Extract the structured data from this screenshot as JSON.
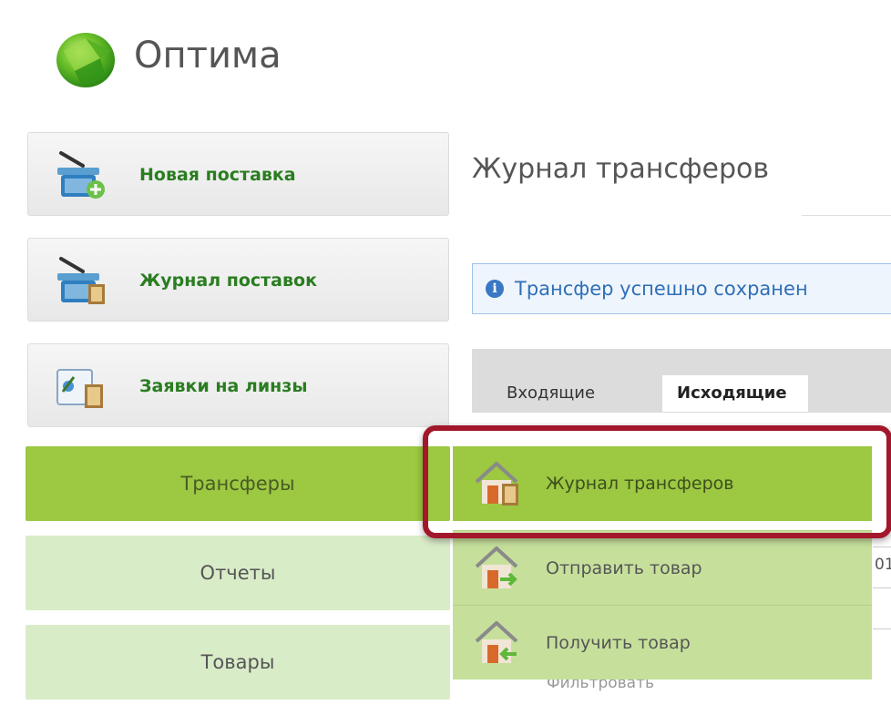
{
  "app": {
    "title": "Оптима",
    "accent": "#9cc842"
  },
  "actions": [
    {
      "label": "Новая поставка",
      "icon": "basket-add-icon"
    },
    {
      "label": "Журнал поставок",
      "icon": "basket-journal-icon"
    },
    {
      "label": "Заявки на линзы",
      "icon": "lens-request-icon"
    }
  ],
  "nav": [
    {
      "label": "Трансферы",
      "state": "active"
    },
    {
      "label": "Отчеты",
      "state": "normal"
    },
    {
      "label": "Товары",
      "state": "normal"
    }
  ],
  "main": {
    "title": "Журнал трансферов",
    "info_text": "Трансфер успешно сохранен",
    "tabs": [
      {
        "label": "Входящие",
        "active": false
      },
      {
        "label": "Исходящие",
        "active": true
      }
    ],
    "peek_text_1": "01",
    "peek_text_2": "Фильтровать"
  },
  "submenu": [
    {
      "label": "Журнал трансферов",
      "icon": "house-journal-icon",
      "highlighted": true
    },
    {
      "label": "Отправить товар",
      "icon": "house-send-icon",
      "highlighted": false
    },
    {
      "label": "Получить товар",
      "icon": "house-receive-icon",
      "highlighted": false
    }
  ],
  "colors": {
    "callout": "#a3172b",
    "info": "#2f6fb6",
    "label_green": "#2a7d20"
  }
}
